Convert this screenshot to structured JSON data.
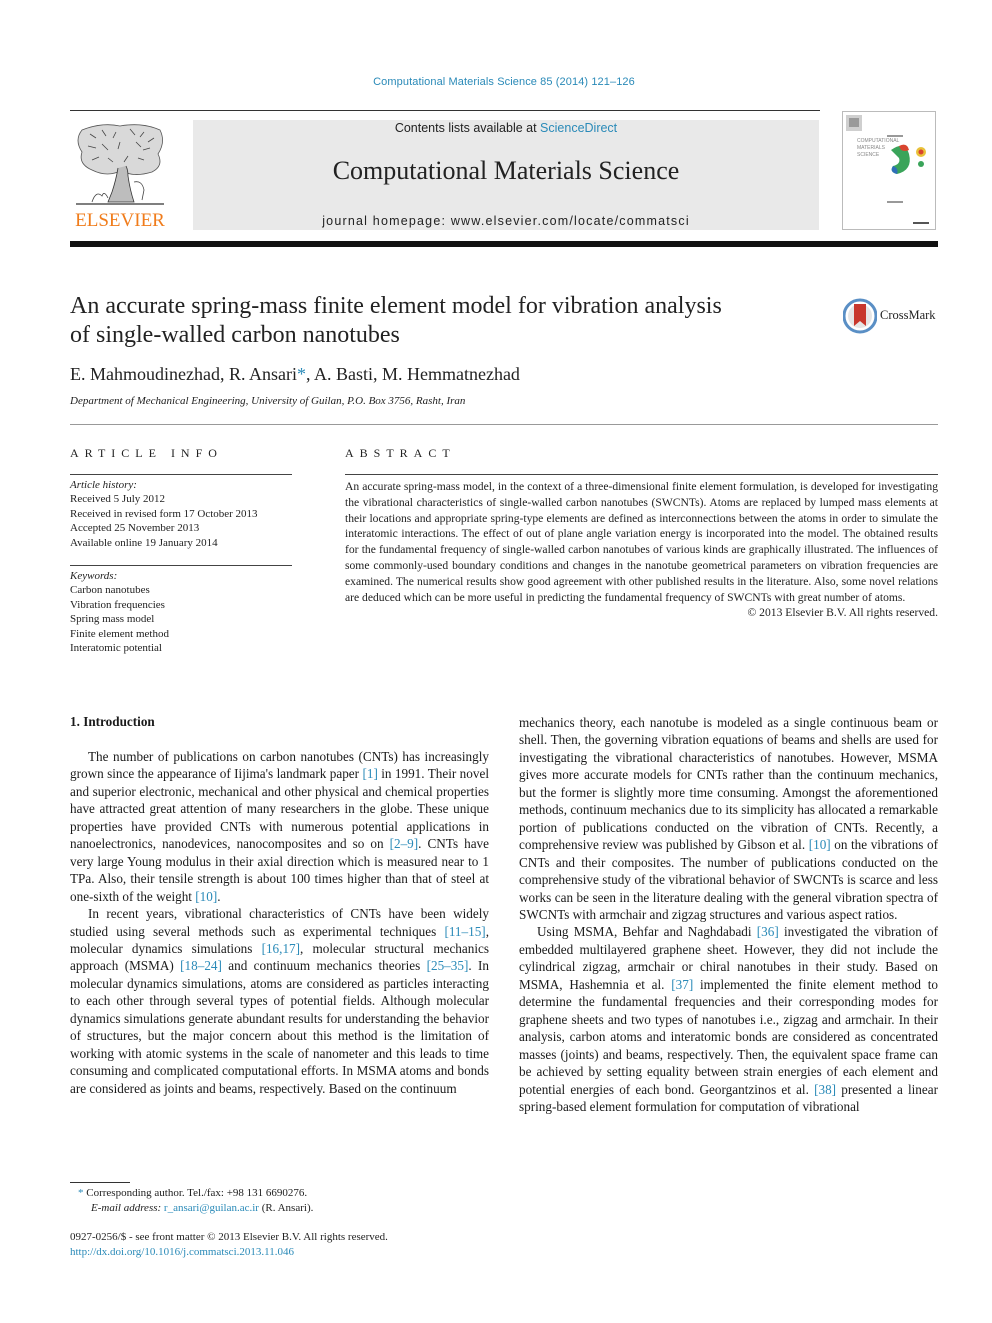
{
  "header": {
    "journal_citation": "Computational Materials Science 85 (2014) 121–126",
    "contents_prefix": "Contents lists available at ",
    "contents_link": "ScienceDirect",
    "journal_title": "Computational Materials Science",
    "homepage_prefix": "journal homepage: ",
    "homepage_url": "www.elsevier.com/locate/commatsci",
    "publisher_logo_text": "ELSEVIER",
    "cover_title_lines": [
      "COMPUTATIONAL",
      "MATERIALS",
      "SCIENCE"
    ],
    "crossmark_label": "CrossMark"
  },
  "article": {
    "title_line1": "An accurate spring-mass finite element model for vibration analysis",
    "title_line2": "of single-walled carbon nanotubes",
    "authors_before_star": "E. Mahmoudinezhad, R. Ansari",
    "star": "*",
    "authors_after_star": ", A. Basti, M. Hemmatnezhad",
    "affiliation": "Department of Mechanical Engineering, University of Guilan, P.O. Box 3756, Rasht, Iran"
  },
  "article_info": {
    "heading": "ARTICLE INFO",
    "history_label": "Article history:",
    "history": [
      "Received 5 July 2012",
      "Received in revised form 17 October 2013",
      "Accepted 25 November 2013",
      "Available online 19 January 2014"
    ],
    "keywords_label": "Keywords:",
    "keywords": [
      "Carbon nanotubes",
      "Vibration frequencies",
      "Spring mass model",
      "Finite element method",
      "Interatomic potential"
    ]
  },
  "abstract": {
    "heading": "ABSTRACT",
    "text": "An accurate spring-mass model, in the context of a three-dimensional finite element formulation, is developed for investigating the vibrational characteristics of single-walled carbon nanotubes (SWCNTs). Atoms are replaced by lumped mass elements at their locations and appropriate spring-type elements are defined as interconnections between the atoms in order to simulate the interatomic interactions. The effect of out of plane angle variation energy is incorporated into the model. The obtained results for the fundamental frequency of single-walled carbon nanotubes of various kinds are graphically illustrated. The influences of some commonly-used boundary conditions and changes in the nanotube geometrical parameters on vibration frequencies are examined. The numerical results show good agreement with other published results in the literature. Also, some novel relations are deduced which can be more useful in predicting the fundamental frequency of SWCNTs with great number of atoms.",
    "copyright": "© 2013 Elsevier B.V. All rights reserved."
  },
  "body": {
    "section_heading": "1. Introduction",
    "p1": [
      {
        "t": "The number of publications on carbon nanotubes (CNTs) has increasingly grown since the appearance of Iijima's landmark paper "
      },
      {
        "ref": "[1]"
      },
      {
        "t": " in 1991. Their novel and superior electronic, mechanical and other physical and chemical properties have attracted great attention of many researchers in the globe. These unique properties have provided CNTs with numerous potential applications in nanoelectronics, nanodevices, nanocomposites and so on "
      },
      {
        "ref": "[2–9]"
      },
      {
        "t": ". CNTs have very large Young modulus in their axial direction which is measured near to 1 TPa. Also, their tensile strength is about 100 times higher than that of steel at one-sixth of the weight "
      },
      {
        "ref": "[10]"
      },
      {
        "t": "."
      }
    ],
    "p2": [
      {
        "t": "In recent years, vibrational characteristics of CNTs have been widely studied using several methods such as experimental techniques "
      },
      {
        "ref": "[11–15]"
      },
      {
        "t": ", molecular dynamics simulations "
      },
      {
        "ref": "[16,17]"
      },
      {
        "t": ", molecular structural mechanics approach (MSMA) "
      },
      {
        "ref": "[18–24]"
      },
      {
        "t": " and continuum mechanics theories "
      },
      {
        "ref": "[25–35]"
      },
      {
        "t": ". In molecular dynamics simulations, atoms are considered as particles interacting to each other through several types of potential fields. Although molecular dynamics simulations generate abundant results for understanding the behavior of structures, but the major concern about this method is the limitation of working with atomic systems in the scale of nanometer and this leads to time consuming and complicated computational efforts. In MSMA atoms and bonds are considered as joints and beams, respectively. Based on the continuum mechanics theory, each nanotube is modeled as a single continuous beam or shell. Then, the governing vibration equations of beams and shells are used for investigating the vibrational characteristics of nanotubes. However, MSMA gives more accurate models for CNTs rather than the continuum mechanics, but the former is slightly more time consuming. Amongst the aforementioned methods, continuum mechanics due to its simplicity has allocated a remarkable portion of publications conducted on the vibration of CNTs. Recently, a comprehensive review was published by Gibson et al. "
      },
      {
        "ref": "[10]"
      },
      {
        "t": " on the vibrations of CNTs and their composites. The number of publications conducted on the comprehensive study of the vibrational behavior of SWCNTs is scarce and less works can be seen in the literature dealing with the general vibration spectra of SWCNTs with armchair and zigzag structures and various aspect ratios."
      }
    ],
    "p3": [
      {
        "t": "Using MSMA, Behfar and Naghdabadi "
      },
      {
        "ref": "[36]"
      },
      {
        "t": " investigated the vibration of embedded multilayered graphene sheet. However, they did not include the cylindrical zigzag, armchair or chiral nanotubes in their study. Based on MSMA, Hashemnia et al. "
      },
      {
        "ref": "[37]"
      },
      {
        "t": " implemented the finite element method to determine the fundamental frequencies and their corresponding modes for graphene sheets and two types of nanotubes i.e., zigzag and armchair. In their analysis, carbon atoms and interatomic bonds are considered as concentrated masses (joints) and beams, respectively. Then, the equivalent space frame can be achieved by setting equality between strain energies of each element and potential energies of each bond. Georgantzinos et al. "
      },
      {
        "ref": "[38]"
      },
      {
        "t": " presented a linear spring-based element formulation for computation of vibrational"
      }
    ]
  },
  "footnote": {
    "star": "*",
    "corresponding": " Corresponding author. Tel./fax: +98 131 6690276.",
    "email_label": "E-mail address:",
    "email": "r_ansari@guilan.ac.ir",
    "email_suffix": " (R. Ansari).",
    "issn_line": "0927-0256/$ - see front matter © 2013 Elsevier B.V. All rights reserved.",
    "doi": "http://dx.doi.org/10.1016/j.commatsci.2013.11.046"
  },
  "colors": {
    "link": "#2a8ab8",
    "elsevier_orange": "#f07c1b",
    "banner_bg": "#e9e9e9"
  }
}
